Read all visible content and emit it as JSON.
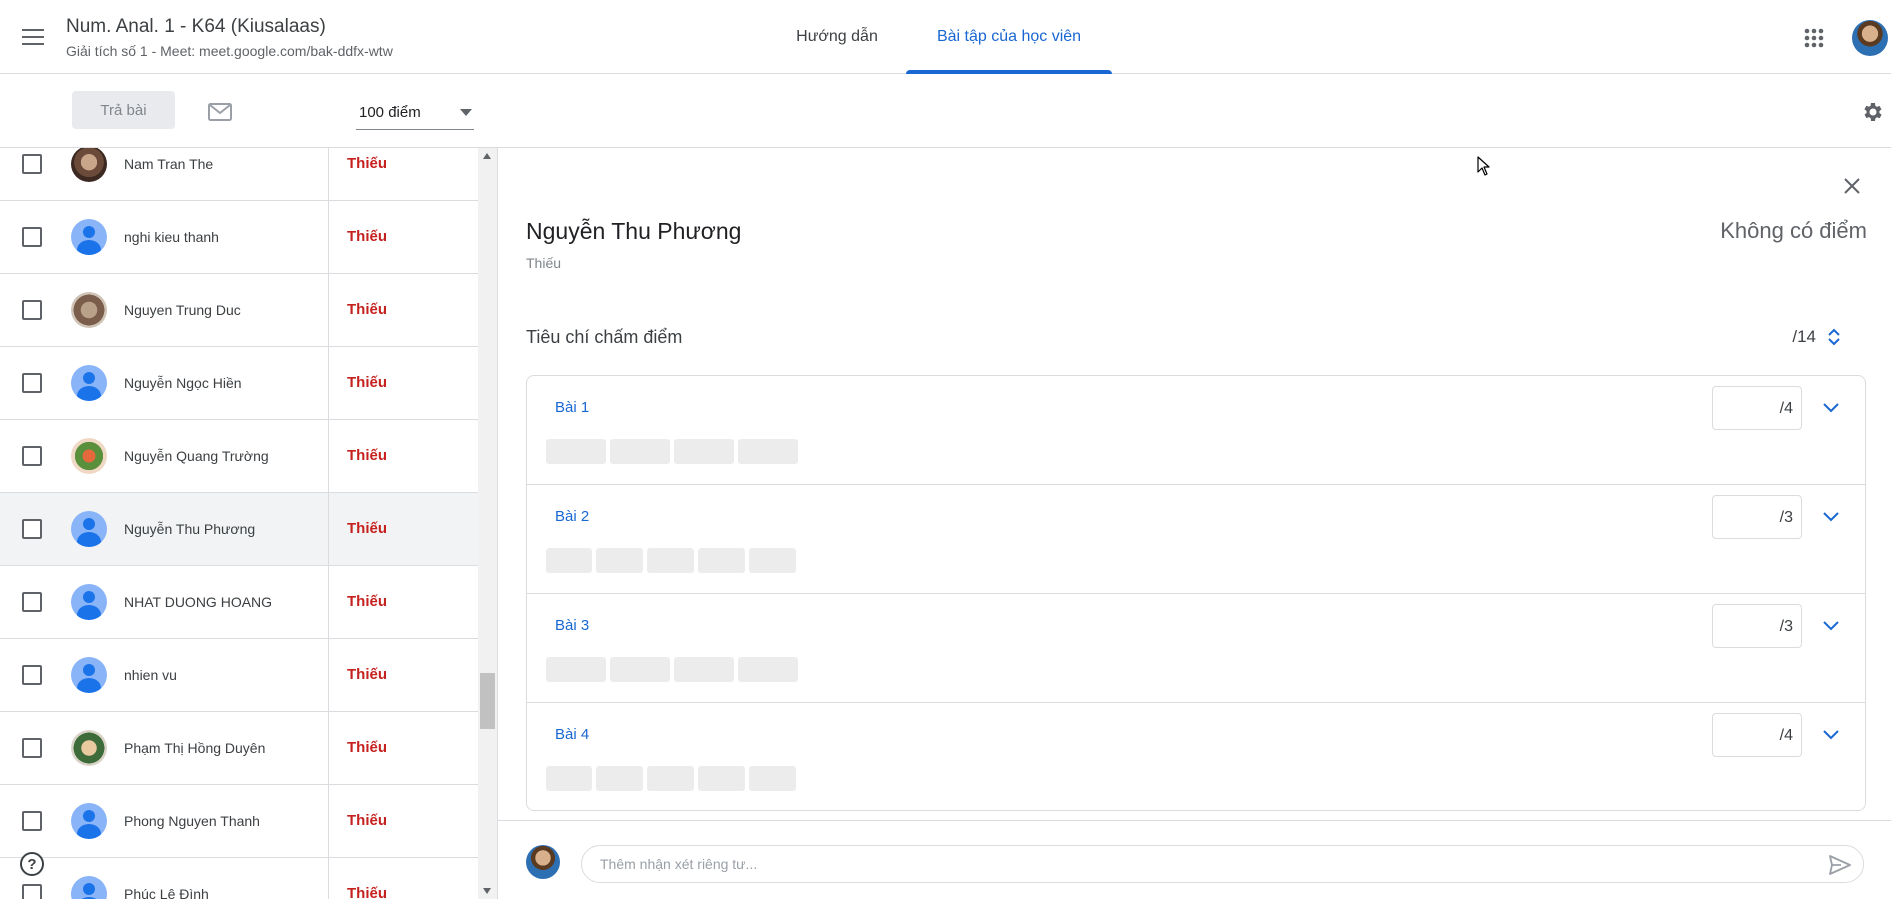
{
  "header": {
    "class_title": "Num. Anal. 1 - K64 (Kiusalaas)",
    "class_subtitle": "Giải tích số 1 - Meet: meet.google.com/bak-ddfx-wtw",
    "tabs": [
      {
        "label": "Hướng dẫn",
        "active": false
      },
      {
        "label": "Bài tập của học viên",
        "active": true
      }
    ],
    "icons": {
      "menu": "hamburger-menu-icon",
      "apps": "apps-grid-icon",
      "account": "account-avatar"
    }
  },
  "toolbar": {
    "return_label": "Trả bài",
    "points_value": "100 điểm",
    "icons": {
      "email": "mail-icon",
      "settings": "gear-icon"
    }
  },
  "students": [
    {
      "name": "Nam Tran The",
      "status": "Thiếu",
      "avatar": "photo-cat",
      "selected": false
    },
    {
      "name": "nghi kieu thanh",
      "status": "Thiếu",
      "avatar": "default",
      "selected": false
    },
    {
      "name": "Nguyen Trung Duc",
      "status": "Thiếu",
      "avatar": "photo-monkey",
      "selected": false
    },
    {
      "name": "Nguyễn Ngọc Hiền",
      "status": "Thiếu",
      "avatar": "default",
      "selected": false
    },
    {
      "name": "Nguyễn Quang Trường",
      "status": "Thiếu",
      "avatar": "photo-anime",
      "selected": false
    },
    {
      "name": "Nguyễn Thu Phương",
      "status": "Thiếu",
      "avatar": "default",
      "selected": true
    },
    {
      "name": "NHAT DUONG HOANG",
      "status": "Thiếu",
      "avatar": "default",
      "selected": false
    },
    {
      "name": "nhien vu",
      "status": "Thiếu",
      "avatar": "default",
      "selected": false
    },
    {
      "name": "Phạm Thị Hồng Duyên",
      "status": "Thiếu",
      "avatar": "photo-cat2",
      "selected": false
    },
    {
      "name": "Phong Nguyen Thanh",
      "status": "Thiếu",
      "avatar": "default",
      "selected": false
    },
    {
      "name": "Phúc Lê Đình",
      "status": "Thiếu",
      "avatar": "default",
      "selected": false
    }
  ],
  "detail": {
    "student_name": "Nguyễn Thu Phương",
    "status": "Thiếu",
    "grade": "Không có điểm",
    "rubric": {
      "title": "Tiêu chí chấm điểm",
      "total": "/14",
      "criteria": [
        {
          "title": "Bài 1",
          "max": "/4",
          "levels": 4
        },
        {
          "title": "Bài 2",
          "max": "/3",
          "levels": 5
        },
        {
          "title": "Bài 3",
          "max": "/3",
          "levels": 4
        },
        {
          "title": "Bài 4",
          "max": "/4",
          "levels": 5
        }
      ]
    },
    "comment": {
      "placeholder": "Thêm nhận xét riêng tư..."
    },
    "icons": {
      "close": "close-icon",
      "expand": "expand-collapse-icon",
      "chevron": "chevron-down-icon",
      "send": "send-icon"
    }
  },
  "help": {
    "label": "?"
  },
  "colors": {
    "accent": "#1967d2",
    "missing": "#c5221f",
    "divider": "#dadce0"
  }
}
